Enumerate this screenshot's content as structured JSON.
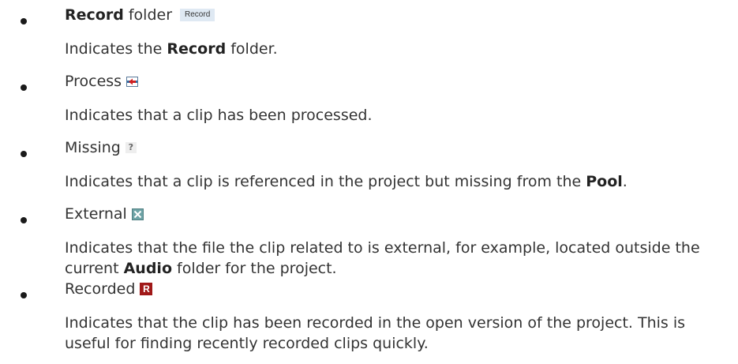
{
  "items": [
    {
      "title_bold": "Record",
      "title_rest": " folder",
      "icon_name": "record-folder-icon",
      "icon_text": "Record",
      "desc_pre": "Indicates the ",
      "desc_bold": "Record",
      "desc_post": " folder."
    },
    {
      "title": "Process",
      "icon_name": "process-icon",
      "desc": "Indicates that a clip has been processed."
    },
    {
      "title": "Missing",
      "icon_name": "missing-icon",
      "icon_text": "?",
      "desc_pre": "Indicates that a clip is referenced in the project but missing from the ",
      "desc_bold": "Pool",
      "desc_post": "."
    },
    {
      "title": "External",
      "icon_name": "external-icon",
      "desc_pre": "Indicates that the file the clip related to is external, for example, located outside the current ",
      "desc_bold": "Audio",
      "desc_post": " folder for the project."
    },
    {
      "title": "Recorded",
      "icon_name": "recorded-icon",
      "icon_text": "R",
      "desc": "Indicates that the clip has been recorded in the open version of the project. This is useful for finding recently recorded clips quickly."
    }
  ]
}
